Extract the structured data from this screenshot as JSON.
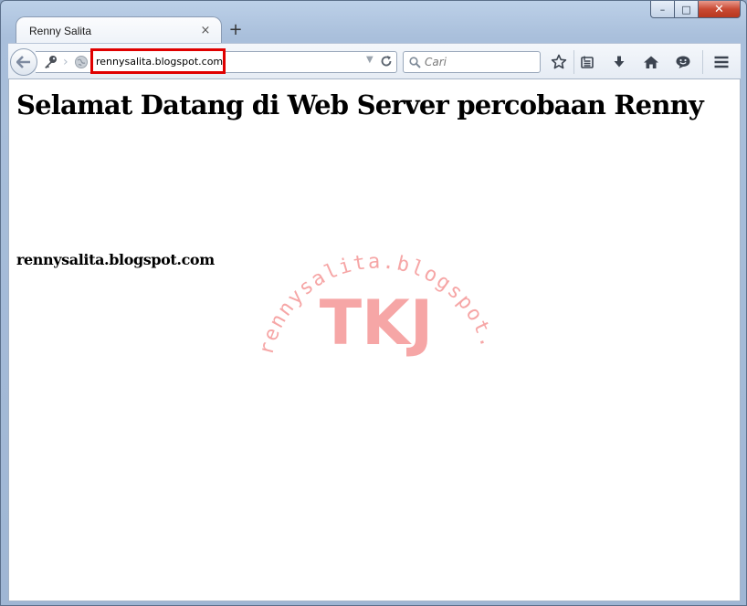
{
  "browser": {
    "tab": {
      "title": "Renny Salita"
    },
    "window_controls": {
      "minimize": "–",
      "maximize": "□",
      "close": "✕"
    },
    "tab_close": "×",
    "newtab_label": "+",
    "address": {
      "value": "rennysalita.blogspot.com"
    },
    "search": {
      "placeholder": "Cari"
    },
    "toolbar_icons": [
      "bookmark-star-icon",
      "reading-list-icon",
      "download-icon",
      "home-icon",
      "smiley-icon",
      "hamburger-menu-icon"
    ]
  },
  "page": {
    "heading": "Selamat Datang di Web Server percobaan Renny",
    "subheading": "rennysalita.blogspot.com"
  },
  "watermark": {
    "arc_text": "rennysalita.blogspot.com",
    "center_text": "TKJ",
    "color": "#f6a6a6"
  },
  "colors": {
    "url_highlight": "#e00000",
    "close_button": "#c94a33"
  }
}
